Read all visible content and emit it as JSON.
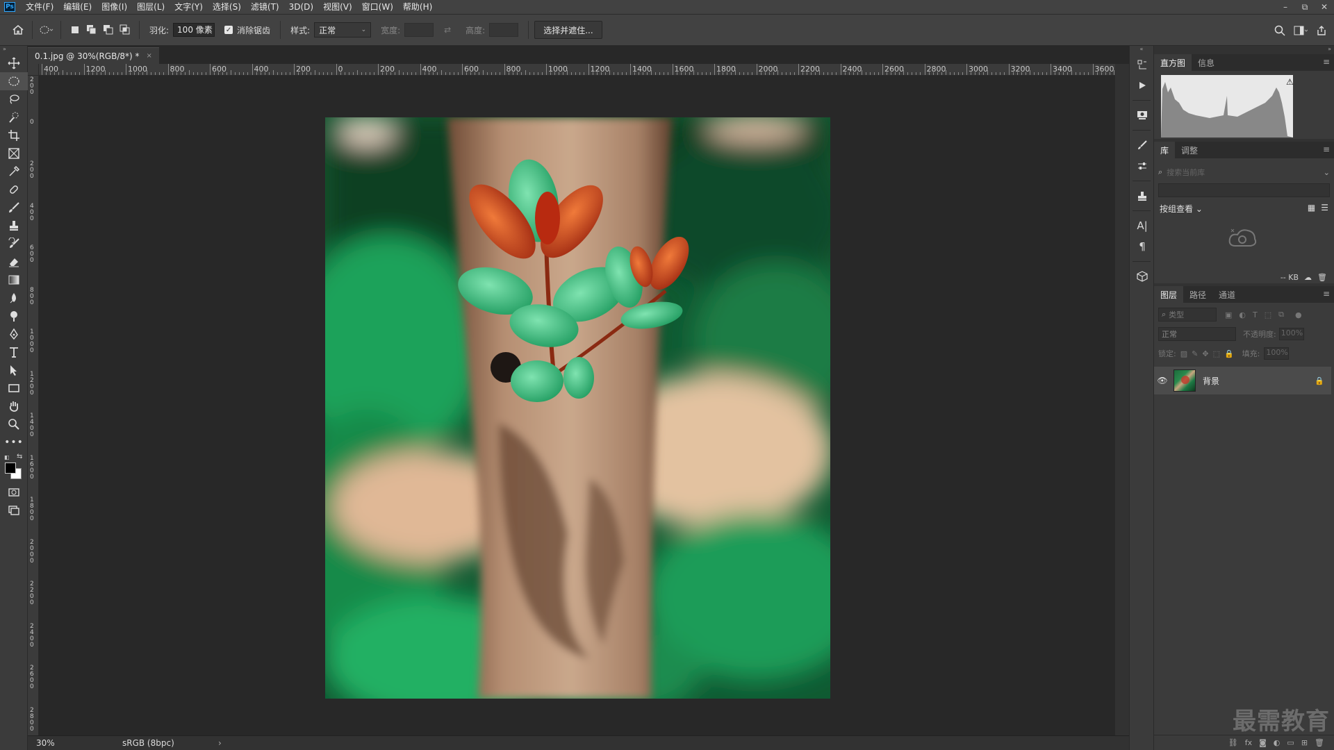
{
  "app": {
    "logo": "Ps"
  },
  "menu": [
    "文件(F)",
    "编辑(E)",
    "图像(I)",
    "图层(L)",
    "文字(Y)",
    "选择(S)",
    "滤镜(T)",
    "3D(D)",
    "视图(V)",
    "窗口(W)",
    "帮助(H)"
  ],
  "window_controls": {
    "minimize": "–",
    "restore": "⧉",
    "close": "✕"
  },
  "options": {
    "feather_label": "羽化:",
    "feather_value": "100 像素",
    "antialias_label": "消除锯齿",
    "antialias_checked": true,
    "style_label": "样式:",
    "style_value": "正常",
    "width_label": "宽度:",
    "height_label": "高度:",
    "select_mask_button": "选择并遮住..."
  },
  "document": {
    "tab_title": "0.1.jpg @ 30%(RGB/8*) *",
    "tab_close": "×",
    "zoom": "30%",
    "color_profile": "sRGB (8bpc)",
    "status_arrow": "›"
  },
  "ruler_h_labels": [
    "400",
    "1200",
    "1000",
    "800",
    "600",
    "400",
    "200",
    "0",
    "200",
    "400",
    "600",
    "800",
    "1000",
    "1200",
    "1400",
    "1600",
    "1800",
    "2000",
    "2200",
    "2400",
    "2600",
    "2800",
    "3000",
    "3200",
    "3400",
    "3600"
  ],
  "ruler_v_labels": [
    "200",
    "0",
    "200",
    "400",
    "600",
    "800",
    "1000",
    "1200",
    "1400",
    "1600",
    "1800",
    "2000",
    "2200",
    "2400",
    "2600",
    "2800"
  ],
  "panels": {
    "histogram_tabs": [
      "直方图",
      "信息"
    ],
    "histogram_warning": "⚠",
    "library_tabs": [
      "库",
      "调整"
    ],
    "library_search_placeholder": "搜索当前库",
    "library_view_label": "按组查看",
    "library_size": "-- KB",
    "layers_tabs": [
      "图层",
      "路径",
      "通道"
    ],
    "layers_filter_label": "类型",
    "blend_mode": "正常",
    "opacity_label": "不透明度:",
    "opacity_value": "100%",
    "lock_label": "锁定:",
    "fill_label": "填充:",
    "fill_value": "100%",
    "layer_name": "背景",
    "footer_icons": [
      "link-icon",
      "fx",
      "mask-icon",
      "adjustment-icon",
      "folder-icon",
      "new-layer-icon",
      "trash-icon"
    ],
    "footer_fx": "fx"
  },
  "watermark": "最需教育",
  "colors": {
    "accent": "#31a8ff",
    "panel_bg": "#3b3b3b",
    "canvas_bg": "#282828"
  }
}
